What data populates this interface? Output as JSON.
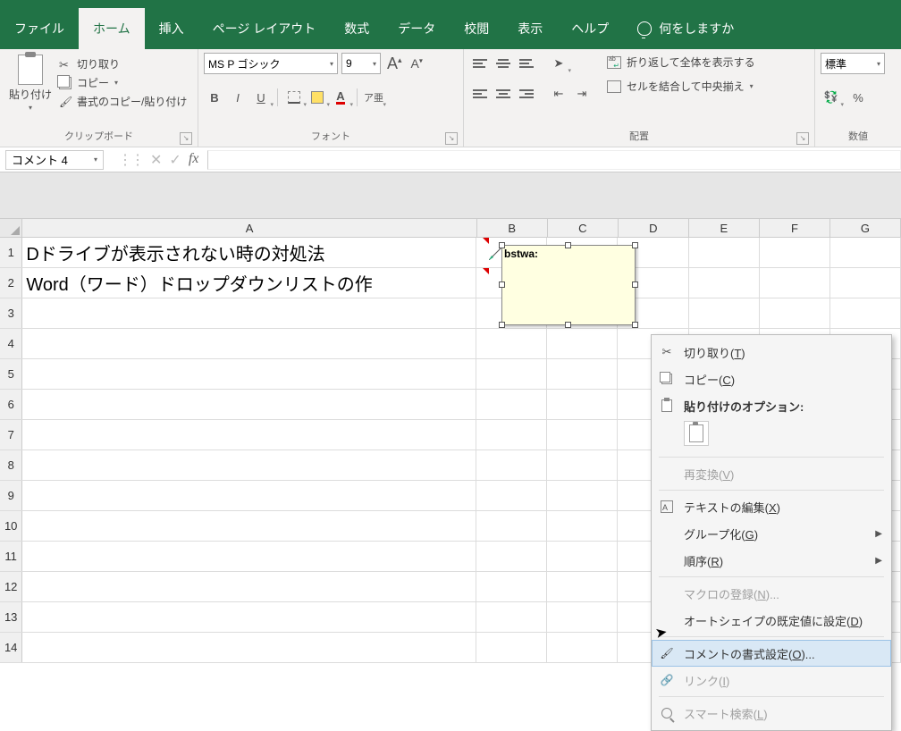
{
  "tabs": {
    "file": "ファイル",
    "home": "ホーム",
    "insert": "挿入",
    "page_layout": "ページ レイアウト",
    "formulas": "数式",
    "data": "データ",
    "review": "校閲",
    "view": "表示",
    "help": "ヘルプ",
    "tell_me": "何をしますか"
  },
  "ribbon": {
    "clipboard": {
      "paste": "貼り付け",
      "cut": "切り取り",
      "copy": "コピー",
      "format_painter": "書式のコピー/貼り付け",
      "label": "クリップボード"
    },
    "font": {
      "name": "MS P ゴシック",
      "size": "9",
      "label": "フォント"
    },
    "alignment": {
      "wrap": "折り返して全体を表示する",
      "merge": "セルを結合して中央揃え",
      "label": "配置"
    },
    "number": {
      "format": "標準",
      "label": "数値"
    }
  },
  "formula_bar": {
    "name_box": "コメント 4"
  },
  "columns": [
    "A",
    "B",
    "C",
    "D",
    "E",
    "F",
    "G"
  ],
  "rows": [
    "1",
    "2",
    "3",
    "4",
    "5",
    "6",
    "7",
    "8",
    "9",
    "10",
    "11",
    "12",
    "13",
    "14"
  ],
  "cells": {
    "A1": "Dドライブが表示されない時の対処法",
    "A2": "Word（ワード）ドロップダウンリストの作"
  },
  "comment": {
    "author": "bstwa:"
  },
  "context_menu": {
    "cut": "切り取り(",
    "cut_k": "T",
    "copy": "コピー(",
    "copy_k": "C",
    "paste_options": "貼り付けのオプション:",
    "reconvert": "再変換(",
    "reconvert_k": "V",
    "edit_text": "テキストの編集(",
    "edit_text_k": "X",
    "group": "グループ化(",
    "group_k": "G",
    "order": "順序(",
    "order_k": "R",
    "assign_macro": "マクロの登録(",
    "assign_macro_k": "N",
    "assign_macro_suffix": ")...",
    "default_autoshape": "オートシェイプの既定値に設定(",
    "default_autoshape_k": "D",
    "format_comment": "コメントの書式設定(",
    "format_comment_k": "O",
    "format_comment_suffix": ")...",
    "link": "リンク(",
    "link_k": "I",
    "smart_lookup": "スマート検索(",
    "smart_lookup_k": "L",
    "close_paren": ")"
  }
}
